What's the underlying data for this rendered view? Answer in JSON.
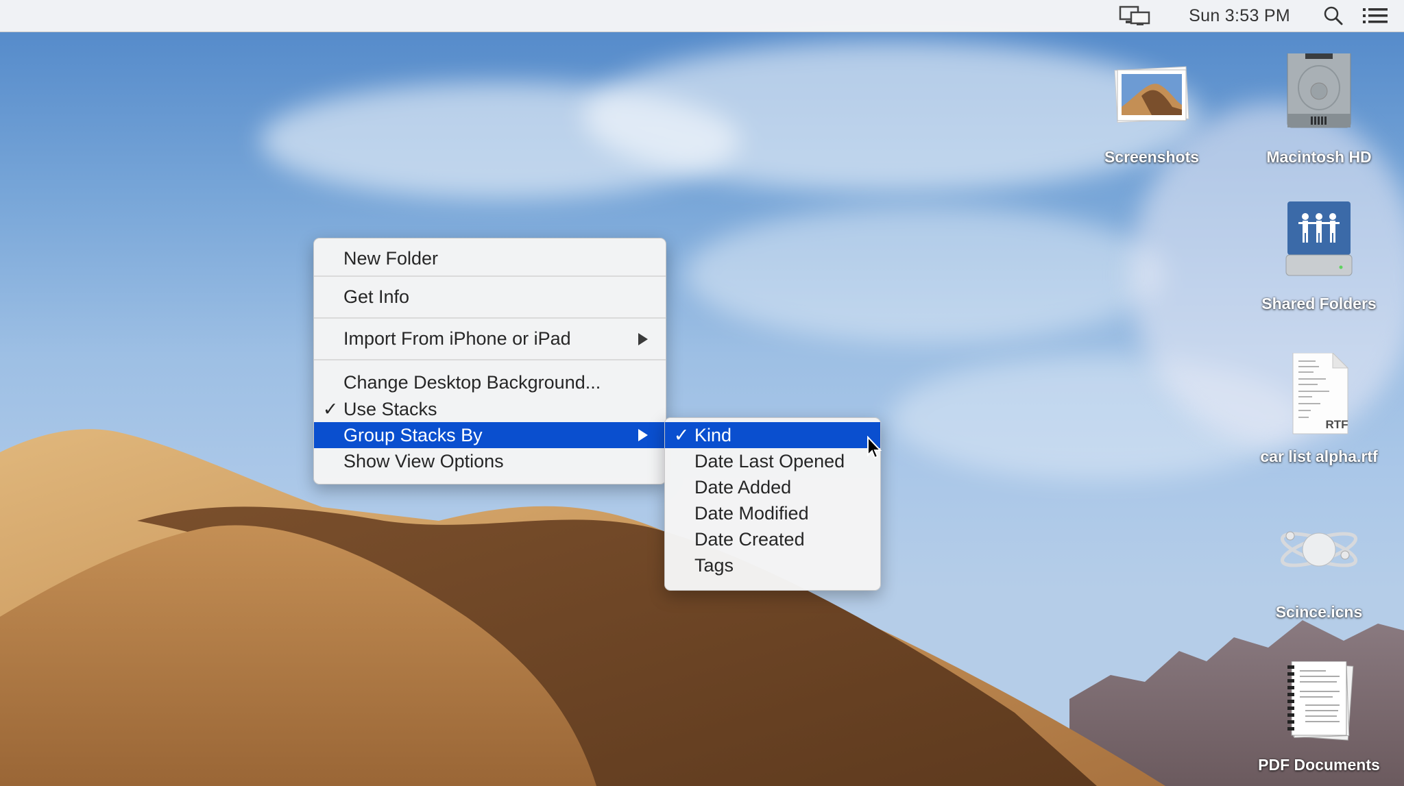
{
  "menubar": {
    "display_icon": "screen-mirroring-icon",
    "clock": "Sun 3:53 PM",
    "search_icon": "spotlight-search-icon",
    "notification_icon": "notification-center-icon"
  },
  "context_menu": {
    "items": [
      {
        "label": "New Folder",
        "checked": false,
        "submenu": false,
        "highlighted": false
      },
      {
        "label": "Get Info",
        "checked": false,
        "submenu": false,
        "highlighted": false
      },
      {
        "label": "Import From iPhone or iPad",
        "checked": false,
        "submenu": true,
        "highlighted": false
      },
      {
        "label": "Change Desktop Background...",
        "checked": false,
        "submenu": false,
        "highlighted": false
      },
      {
        "label": "Use Stacks",
        "checked": true,
        "submenu": false,
        "highlighted": false
      },
      {
        "label": "Group Stacks By",
        "checked": false,
        "submenu": true,
        "highlighted": true
      },
      {
        "label": "Show View Options",
        "checked": false,
        "submenu": false,
        "highlighted": false
      }
    ],
    "check_glyph": "✓",
    "highlight_color": "#0a4fcf"
  },
  "group_stacks_submenu": {
    "items": [
      {
        "label": "Kind",
        "checked": true,
        "highlighted": true
      },
      {
        "label": "Date Last Opened",
        "checked": false,
        "highlighted": false
      },
      {
        "label": "Date Added",
        "checked": false,
        "highlighted": false
      },
      {
        "label": "Date Modified",
        "checked": false,
        "highlighted": false
      },
      {
        "label": "Date Created",
        "checked": false,
        "highlighted": false
      },
      {
        "label": "Tags",
        "checked": false,
        "highlighted": false
      }
    ]
  },
  "desktop_icons": [
    {
      "label": "Screenshots",
      "icon": "photo-stack-icon"
    },
    {
      "label": "Macintosh HD",
      "icon": "hard-drive-icon"
    },
    {
      "label": "Shared Folders",
      "icon": "shared-drive-icon"
    },
    {
      "label": "car list alpha.rtf",
      "icon": "rtf-document-icon",
      "badge": "RTF"
    },
    {
      "label": "Scince.icns",
      "icon": "atom-icon"
    },
    {
      "label": "PDF Documents",
      "icon": "document-stack-icon"
    }
  ]
}
